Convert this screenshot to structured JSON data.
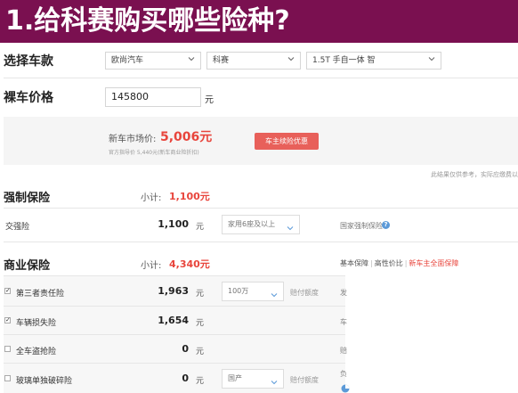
{
  "banner": {
    "title": "1.给科赛购买哪些险种?"
  },
  "select_model": {
    "label": "选择车款",
    "brand": "欧尚汽车",
    "series": "科赛",
    "trim": "1.5T 手自一体 智"
  },
  "bare_price": {
    "label": "裸车价格",
    "value": "145800",
    "unit": "元"
  },
  "market": {
    "label": "新车市场价:",
    "value": "5,006元",
    "note": "官方指导价 5,440元(新车商业险折扣)",
    "promo_button": "车主续险优惠"
  },
  "disclaimer": "此结果仅供参考，实际应缴费以",
  "compulsory": {
    "title": "强制保险",
    "subtotal_label": "小计:",
    "subtotal_value": "1,100元",
    "items": [
      {
        "name": "交强险",
        "amount": "1,100",
        "unit": "元",
        "option": "家用6座及以上",
        "info": "国家强制保险"
      }
    ]
  },
  "commercial": {
    "title": "商业保险",
    "subtotal_label": "小计:",
    "subtotal_value": "4,340元",
    "tabs": [
      "基本保障",
      "高性价比",
      "新车主全面保障"
    ],
    "items": [
      {
        "name": "第三者责任险",
        "amount": "1,963",
        "unit": "元",
        "checked": true,
        "option": "100万",
        "note": "赔付额度",
        "side": "发"
      },
      {
        "name": "车辆损失险",
        "amount": "1,654",
        "unit": "元",
        "checked": true,
        "option": "",
        "note": "",
        "side": "车"
      },
      {
        "name": "全车盗抢险",
        "amount": "0",
        "unit": "元",
        "checked": false,
        "option": "",
        "note": "",
        "side": "赔"
      },
      {
        "name": "玻璃单独破碎险",
        "amount": "0",
        "unit": "元",
        "checked": false,
        "option": "国产",
        "note": "赔付额度",
        "side": "负"
      }
    ]
  },
  "colors": {
    "banner": "#7a1050",
    "accent": "#e8453c",
    "button": "#e8605a"
  },
  "icons": [
    "chevron-down-icon",
    "info-icon",
    "checkbox-icon",
    "pie-chart-icon"
  ]
}
